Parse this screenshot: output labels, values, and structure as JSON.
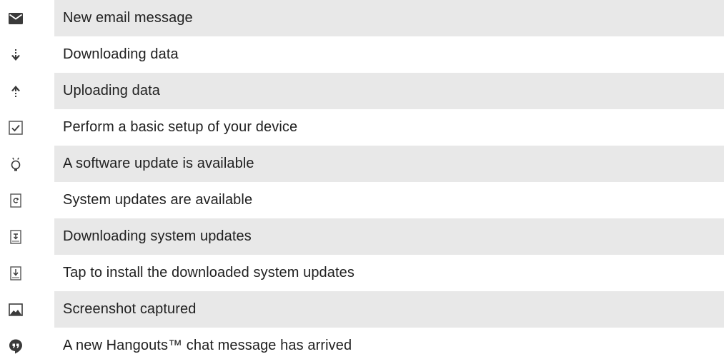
{
  "rows": [
    {
      "icon": "email-icon",
      "label": "New email message"
    },
    {
      "icon": "download-arrow-icon",
      "label": "Downloading data"
    },
    {
      "icon": "upload-arrow-icon",
      "label": "Uploading data"
    },
    {
      "icon": "checkbox-icon",
      "label": "Perform a basic setup of your device"
    },
    {
      "icon": "lightbulb-icon",
      "label": "A software update is available"
    },
    {
      "icon": "system-update-icon",
      "label": "System updates are available"
    },
    {
      "icon": "system-download-icon",
      "label": "Downloading system updates"
    },
    {
      "icon": "install-update-icon",
      "label": "Tap to install the downloaded system updates"
    },
    {
      "icon": "screenshot-icon",
      "label": "Screenshot captured"
    },
    {
      "icon": "hangouts-icon",
      "label": "A new Hangouts™ chat message has arrived"
    }
  ]
}
